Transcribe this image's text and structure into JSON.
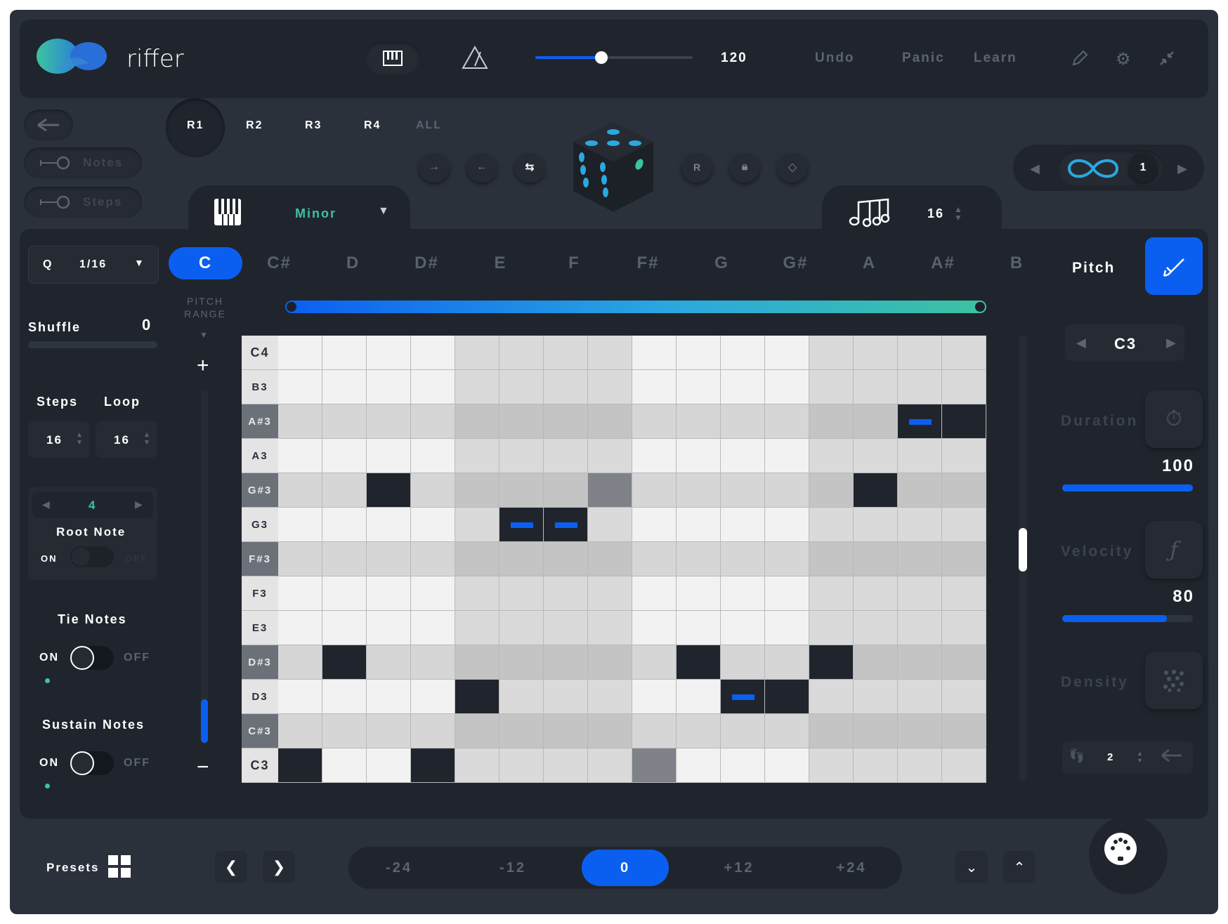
{
  "app": {
    "name": "riffer"
  },
  "topbar": {
    "tempo": "120",
    "undo": "Undo",
    "panic": "Panic",
    "learn": "Learn",
    "tempo_level": 0.42
  },
  "left_toggles": {
    "notes": "Notes",
    "steps": "Steps"
  },
  "riff_tabs": [
    "R1",
    "R2",
    "R3",
    "R4",
    "ALL"
  ],
  "loop_panel": {
    "count": "1"
  },
  "scale": {
    "name": "Minor"
  },
  "steps_top": {
    "value": "16"
  },
  "quantize": {
    "label": "Q",
    "value": "1/16"
  },
  "shuffle": {
    "label": "Shuffle",
    "value": "0"
  },
  "steps_loop": {
    "steps_label": "Steps",
    "loop_label": "Loop",
    "steps": "16",
    "loop": "16"
  },
  "root_note": {
    "value": "4",
    "label": "Root Note",
    "on": "ON",
    "off": "OFF"
  },
  "tie_notes": {
    "label": "Tie Notes",
    "on": "ON",
    "off": "OFF"
  },
  "sustain_notes": {
    "label": "Sustain Notes",
    "on": "ON",
    "off": "OFF"
  },
  "keys": [
    "C",
    "C#",
    "D",
    "D#",
    "E",
    "F",
    "F#",
    "G",
    "G#",
    "A",
    "A#",
    "B"
  ],
  "pitch_range": {
    "line1": "PITCH",
    "line2": "RANGE",
    "plus": "+",
    "minus": "−"
  },
  "grid": {
    "rows": [
      "C4",
      "B3",
      "A#3",
      "A3",
      "G#3",
      "G3",
      "F#3",
      "F3",
      "E3",
      "D#3",
      "D3",
      "C#3",
      "C3"
    ],
    "sharp_rows": [
      "A#3",
      "G#3",
      "F#3",
      "D#3",
      "C#3"
    ]
  },
  "right_panel": {
    "pitch_label": "Pitch",
    "note": "C3",
    "duration_label": "Duration",
    "duration_value": "100",
    "duration_level": 1.0,
    "velocity_label": "Velocity",
    "velocity_value": "80",
    "velocity_level": 0.8,
    "density_label": "Density",
    "stepper_value": "2"
  },
  "bottombar": {
    "presets": "Presets",
    "octaves": [
      "-24",
      "-12",
      "0",
      "+12",
      "+24"
    ],
    "selected_octave": "0"
  },
  "colors": {
    "accent": "#0b5ff0",
    "teal": "#3cc3a0",
    "bg": "#2b313b",
    "panel": "#20252d"
  }
}
